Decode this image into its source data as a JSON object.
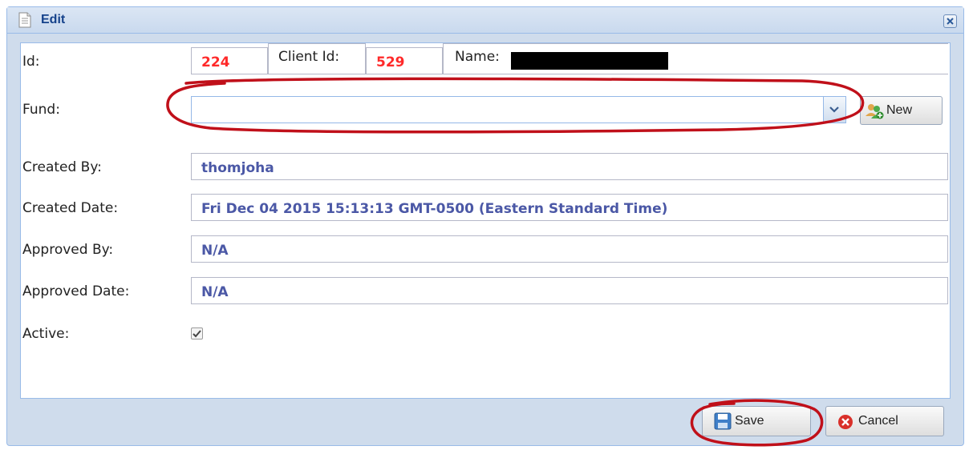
{
  "window": {
    "title": "Edit"
  },
  "form": {
    "id_label": "Id:",
    "id_value": "224",
    "client_id_label": "Client Id:",
    "client_id_value": "529",
    "name_label": "Name:",
    "fund_label": "Fund:",
    "fund_value": "",
    "new_button_label": "New",
    "created_by_label": "Created By:",
    "created_by_value": "thomjoha",
    "created_date_label": "Created Date:",
    "created_date_value": "Fri Dec 04 2015 15:13:13 GMT-0500 (Eastern Standard Time)",
    "approved_by_label": "Approved By:",
    "approved_by_value": "N/A",
    "approved_date_label": "Approved Date:",
    "approved_date_value": "N/A",
    "active_label": "Active:",
    "active_checked": true
  },
  "footer": {
    "save_label": "Save",
    "cancel_label": "Cancel"
  },
  "colors": {
    "accent": "#15428b",
    "value_text": "#4b58a6",
    "id_text": "#ff2a2a",
    "annotation": "#c0101a"
  }
}
